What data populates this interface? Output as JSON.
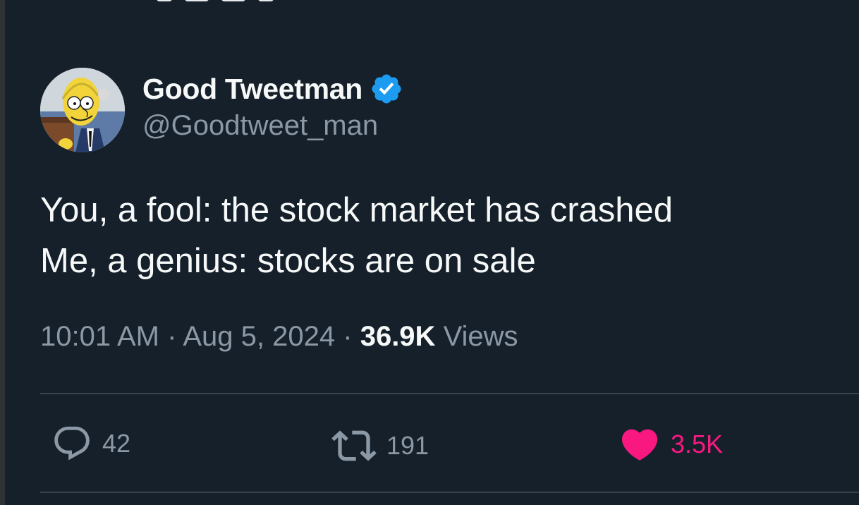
{
  "tweet": {
    "author": {
      "display_name": "Good Tweetman",
      "handle": "@Goodtweet_man",
      "verified": true,
      "verified_color": "#1d9bf0"
    },
    "text_lines": [
      "You, a fool: the stock market has crashed",
      "Me, a genius: stocks are on sale"
    ],
    "time": "10:01 AM",
    "separator": "·",
    "date": "Aug 5, 2024",
    "views_count": "36.9K",
    "views_label": "Views"
  },
  "actions": {
    "reply": {
      "icon": "reply-icon",
      "count": "42"
    },
    "retweet": {
      "icon": "retweet-icon",
      "count": "191"
    },
    "like": {
      "icon": "heart-icon",
      "count": "3.5K",
      "active": true,
      "color": "#f91880"
    }
  },
  "theme": {
    "background": "#15202b",
    "text": "#f7f9f9",
    "secondary": "#8b98a5",
    "divider": "#38444d"
  }
}
